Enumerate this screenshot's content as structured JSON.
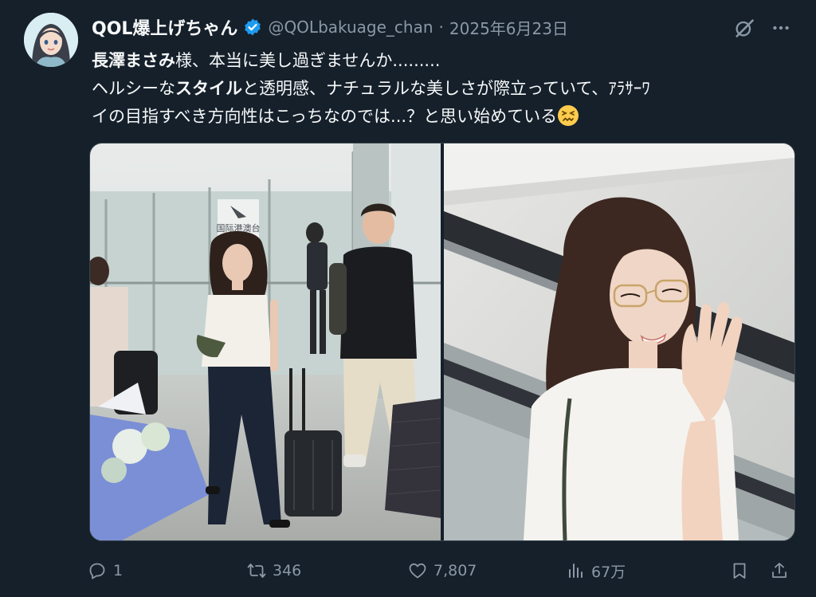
{
  "author": {
    "display_name": "QOL爆上げちゃん",
    "handle": "@QOLbakuage_chan",
    "separator": "·",
    "date": "2025年6月23日",
    "verified_color": "#1d9bf0"
  },
  "tweet": {
    "line1_bold": "長澤まさみ",
    "line1_rest": "様、本当に美し過ぎませんか.........",
    "line2_pre": "ヘルシーな",
    "line2_bold": "スタイル",
    "line2_post": "と透明感、ナチュラルな美しさが際立っていて、ｱﾗｻｰﾜ",
    "line3": "イの目指すべき方向性はこっちなのでは...？と思い始めている",
    "emoji": "confounded-face-emoji"
  },
  "media": {
    "photo1_sign_line1": "国际港澳台",
    "photo1_sign_line2": "到达"
  },
  "actions": {
    "replies": "1",
    "retweets": "346",
    "likes": "7,807",
    "views": "67万"
  },
  "icons": {
    "more": "more-dots-icon",
    "grok": "grok-icon",
    "reply": "reply-icon",
    "retweet": "retweet-icon",
    "like": "heart-icon",
    "views": "views-bar-icon",
    "bookmark": "bookmark-icon",
    "share": "share-icon"
  },
  "colors": {
    "background": "#15202b",
    "text": "#f7f9f9",
    "muted": "#8b98a5",
    "border": "#38444d"
  }
}
